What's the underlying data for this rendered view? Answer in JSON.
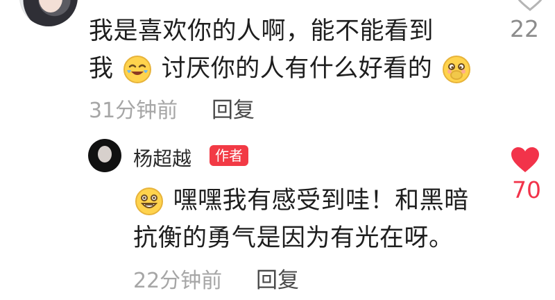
{
  "top_comment": {
    "line1": "我是喜欢你的人啊，能不能看到",
    "line2_before_emoji": "我",
    "line2_after_emoji": "讨厌你的人有什么好看的",
    "time": "31分钟前",
    "reply_label": "回复",
    "likes": "22"
  },
  "reply_comment": {
    "author": "杨超越",
    "author_badge": "作者",
    "line1_after_emoji": "嘿嘿我有感受到哇！和黑暗",
    "line2": "抗衡的勇气是因为有光在呀。",
    "time": "22分钟前",
    "reply_label": "回复",
    "likes": "70"
  },
  "colors": {
    "heart_liked": "#f2334a",
    "badge_bg": "#f23a45",
    "meta_text": "#a6a6a6"
  }
}
